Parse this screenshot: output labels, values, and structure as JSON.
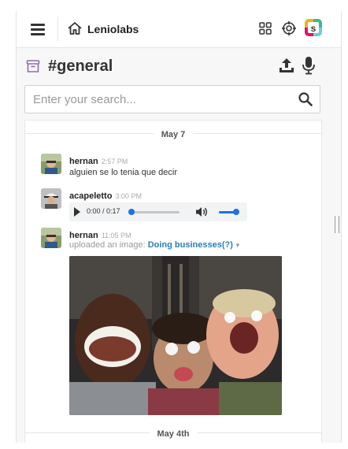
{
  "topbar": {
    "org_name": "Leniolabs",
    "icons": [
      "hamburger-menu-icon",
      "home-icon",
      "grid-icon",
      "target-icon",
      "slack-app-icon"
    ]
  },
  "channel": {
    "name": "#general",
    "icons": [
      "archive-icon",
      "upload-icon",
      "microphone-icon"
    ]
  },
  "search": {
    "placeholder": "Enter your search..."
  },
  "messages": {
    "day1": "May 7",
    "items": [
      {
        "author": "hernan",
        "time": "2:57 PM",
        "text": "alguien se lo tenia que decir"
      },
      {
        "author": "acapeletto",
        "time": "3:00 PM",
        "audio_time": "0:00 / 0:17",
        "audio_progress": 0.0,
        "volume_level": 1.0
      },
      {
        "author": "hernan",
        "time": "11:05 PM",
        "upload_prefix": "uploaded an image:",
        "file_name": "Doing businesses(?)"
      }
    ],
    "day2": "May 4th"
  },
  "colors": {
    "link": "#2a80b9",
    "audio_accent": "#1a73e8",
    "channel_icon": "#8e6bb5"
  }
}
